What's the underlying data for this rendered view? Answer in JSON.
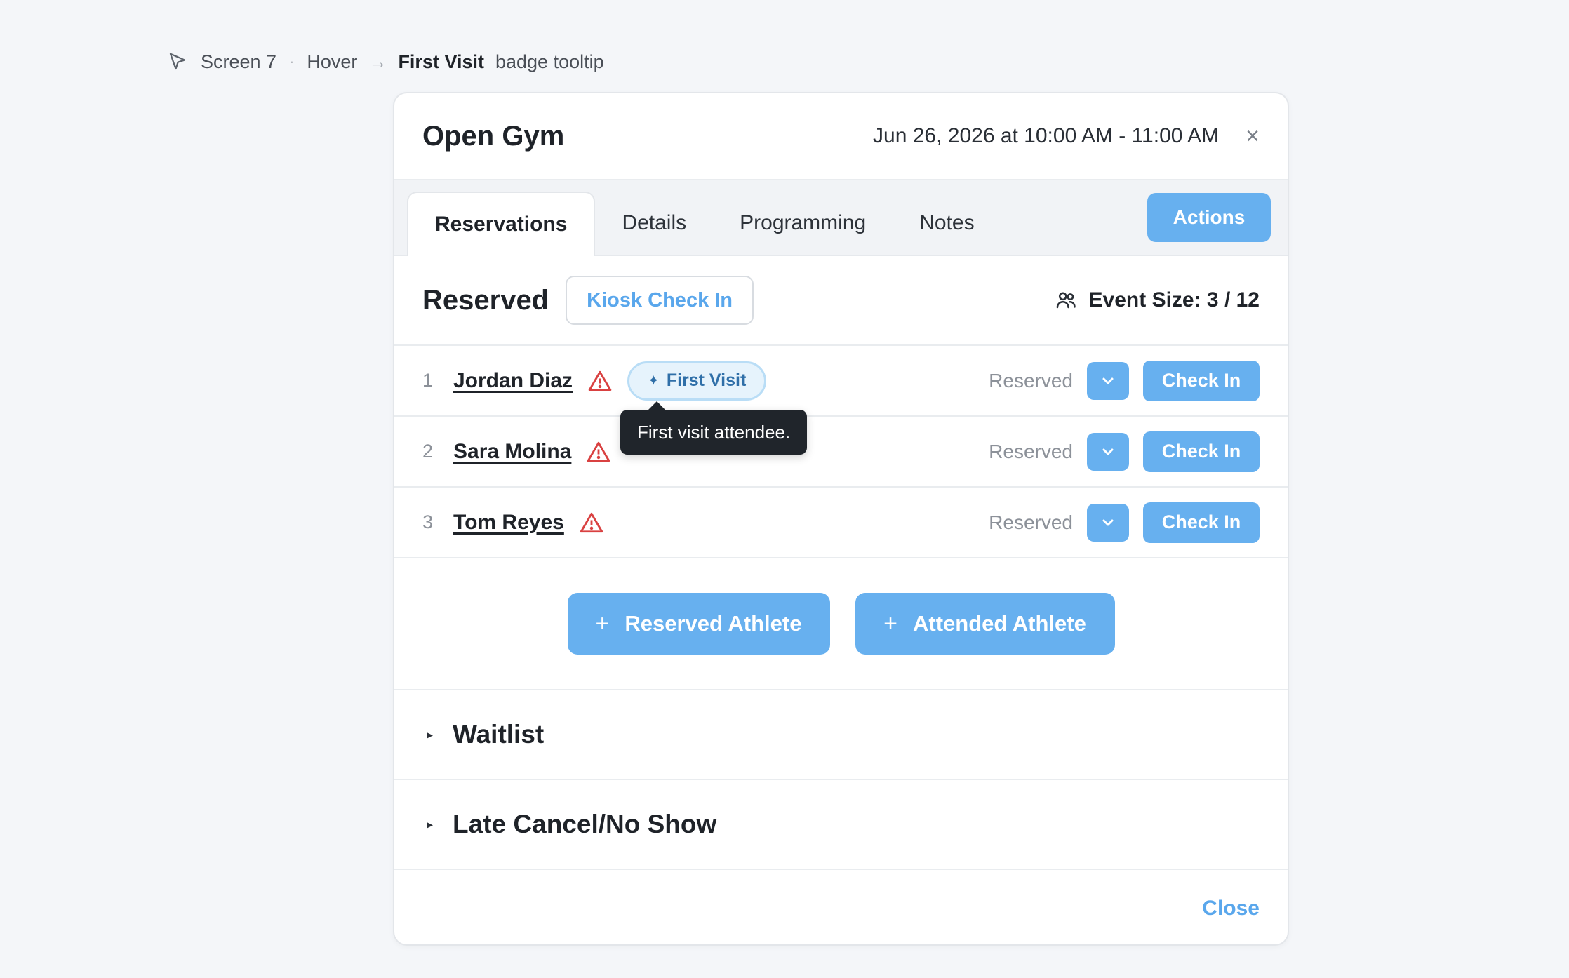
{
  "caption": {
    "screen": "Screen 7",
    "separator": "·",
    "state": "Hover",
    "arrow": "→",
    "target": "First Visit",
    "target_suffix": "badge tooltip"
  },
  "modal": {
    "title": "Open Gym",
    "datetime": "Jun 26, 2026 at 10:00 AM - 11:00 AM",
    "close_symbol": "×"
  },
  "tabs": [
    {
      "label": "Reservations",
      "active": true
    },
    {
      "label": "Details",
      "active": false
    },
    {
      "label": "Programming",
      "active": false
    },
    {
      "label": "Notes",
      "active": false
    }
  ],
  "actions_label": "Actions",
  "reserved": {
    "title": "Reserved",
    "kiosk_label": "Kiosk Check In",
    "event_size_label": "Event Size: 3 / 12"
  },
  "athletes": [
    {
      "num": "1",
      "name": "Jordan Diaz",
      "badge": "First Visit",
      "status": "Reserved",
      "checkin": "Check In"
    },
    {
      "num": "2",
      "name": "Sara Molina",
      "status": "Reserved",
      "checkin": "Check In"
    },
    {
      "num": "3",
      "name": "Tom Reyes",
      "status": "Reserved",
      "checkin": "Check In"
    }
  ],
  "tooltip": "First visit attendee.",
  "add_buttons": {
    "plus": "+",
    "reserved": "Reserved Athlete",
    "attended": "Attended Athlete"
  },
  "sections": {
    "caret": "▸",
    "waitlist": "Waitlist",
    "late_cancel": "Late Cancel/No Show"
  },
  "footer_close": "Close",
  "colors": {
    "accent": "#67b0ef",
    "warning": "#d94141",
    "badge_bg": "#e6f3fc",
    "tooltip_bg": "#20252b"
  },
  "icons": {
    "cursor": "cursor-arrow-icon",
    "people": "people-icon",
    "warning": "warning-triangle-icon",
    "sparkle": "sparkle-icon",
    "chevron": "chevron-down-icon"
  }
}
